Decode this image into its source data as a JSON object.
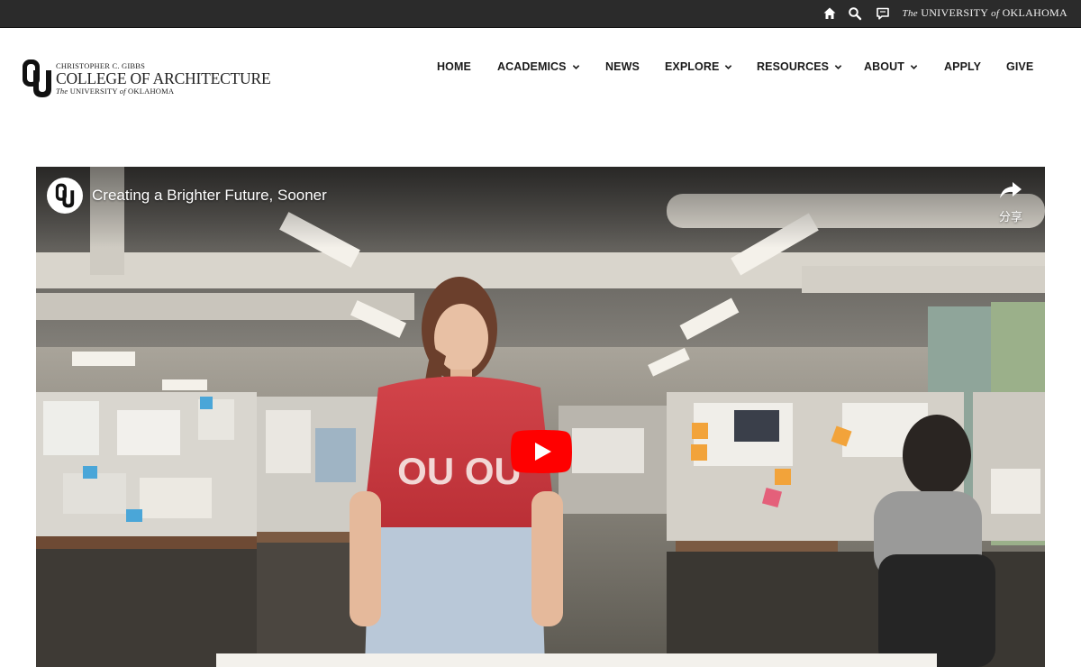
{
  "topbar": {
    "icons": [
      "home-icon",
      "search-icon",
      "chat-icon"
    ],
    "university": {
      "the": "The",
      "name1": "UNIVERSITY",
      "of": "of",
      "name2": "OKLAHOMA"
    }
  },
  "logo": {
    "line1": "CHRISTOPHER C. GIBBS",
    "line2": "COLLEGE OF ARCHITECTURE",
    "line3_the": "The",
    "line3_university": "UNIVERSITY",
    "line3_of": "of",
    "line3_oklahoma": "OKLAHOMA"
  },
  "nav": {
    "items": [
      {
        "label": "HOME",
        "dropdown": false
      },
      {
        "label": "ACADEMICS",
        "dropdown": true
      },
      {
        "label": "NEWS",
        "dropdown": false
      },
      {
        "label": "EXPLORE",
        "dropdown": true
      },
      {
        "label": "RESOURCES",
        "dropdown": true
      },
      {
        "label": "ABOUT",
        "dropdown": true
      },
      {
        "label": "APPLY",
        "dropdown": false
      },
      {
        "label": "GIVE",
        "dropdown": false
      }
    ]
  },
  "video": {
    "title": "Creating a Brighter Future, Sooner",
    "share_label": "分享",
    "play_color": "#ff0000",
    "shirt_text": "OU OU",
    "icons": [
      "ou-channel-icon",
      "share-icon",
      "play-icon"
    ]
  },
  "colors": {
    "topbar_bg": "#2b2b2b",
    "ou_crimson": "#841617",
    "shirt_red": "#c8343a"
  }
}
